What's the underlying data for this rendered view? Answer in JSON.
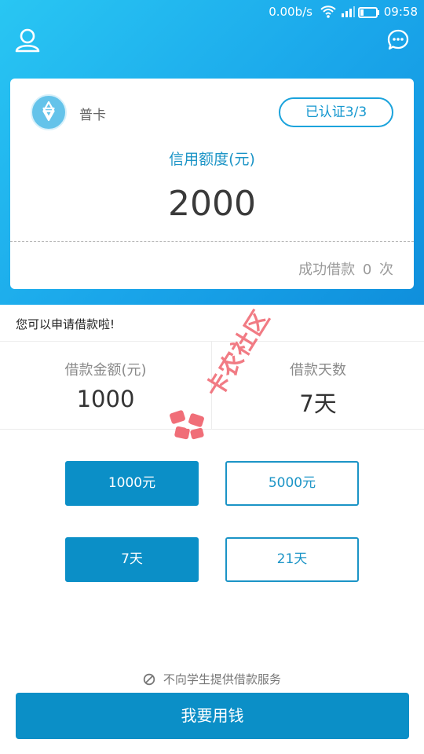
{
  "status_bar": {
    "speed": "0.00b/s",
    "time": "09:58"
  },
  "header": {
    "user_icon": "user-icon",
    "chat_icon": "chat-icon"
  },
  "credit_card": {
    "level": "普卡",
    "verify_label": "已认证3/3",
    "credit_label": "信用额度(元)",
    "credit_amount": "2000",
    "success_prefix": "成功借款",
    "success_count": "0",
    "success_suffix": "次"
  },
  "prompt": {
    "text": "您可以申请借款啦!"
  },
  "summary": {
    "amount_label": "借款金额(元)",
    "amount_value": "1000",
    "days_label": "借款天数",
    "days_value": "7天"
  },
  "watermark": {
    "text": "卡农社区"
  },
  "options": {
    "amounts": [
      {
        "label": "1000元"
      },
      {
        "label": "5000元"
      }
    ],
    "days": [
      {
        "label": "7天"
      },
      {
        "label": "21天"
      }
    ]
  },
  "notice": {
    "text": "不向学生提供借款服务"
  },
  "main_button": {
    "label": "我要用钱"
  },
  "colors": {
    "accent": "#0b8fc7",
    "hero_start": "#29c6f3",
    "hero_end": "#0f8fdc",
    "watermark": "#ef5f6a"
  }
}
